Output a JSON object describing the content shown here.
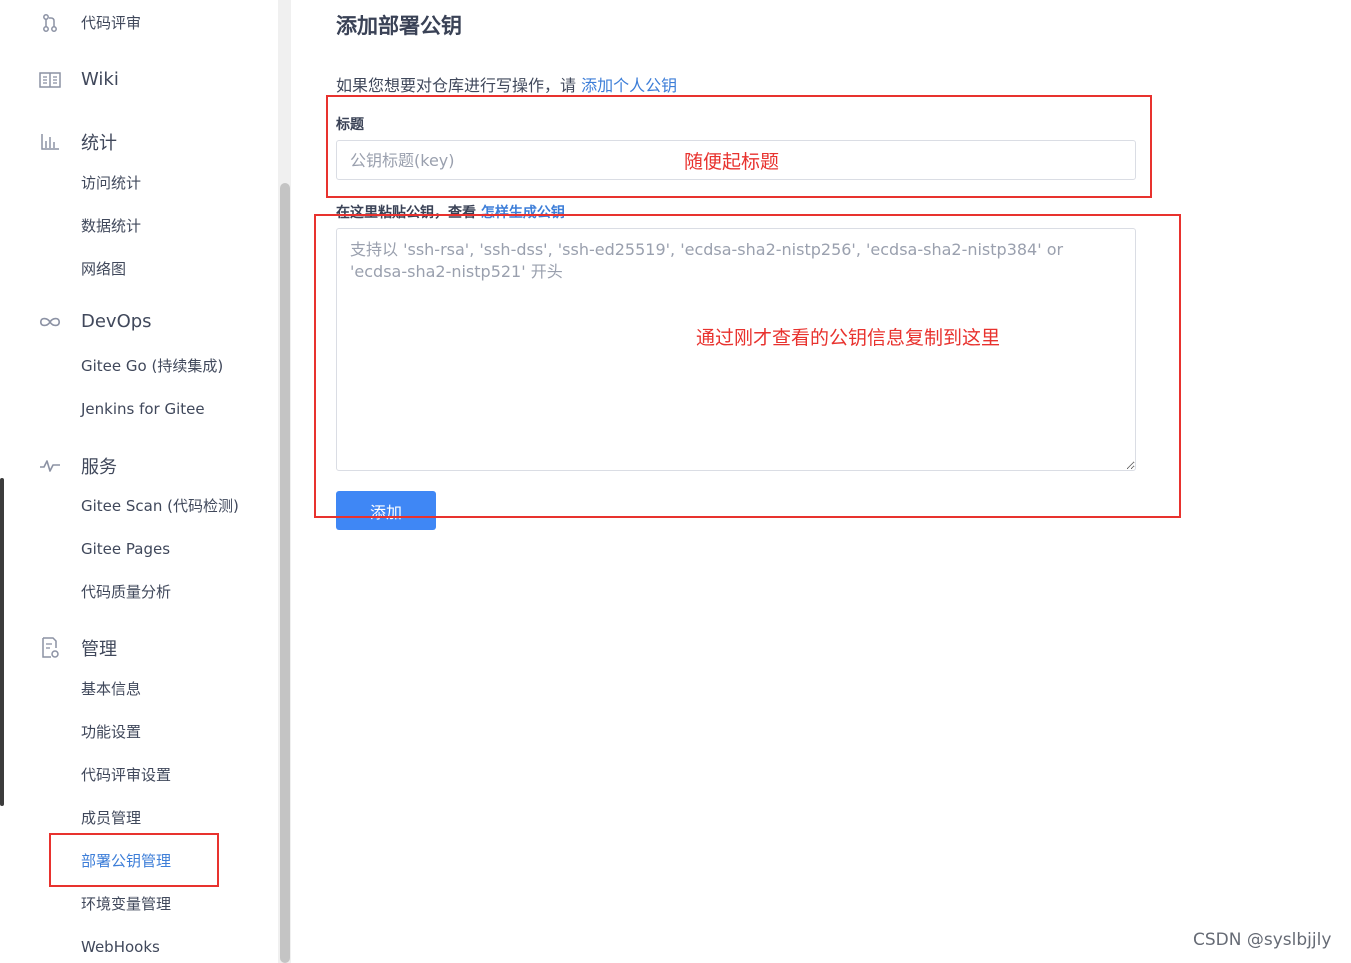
{
  "sidebar": {
    "groups": [
      {
        "label": "代码评审",
        "icon": "code-review-icon"
      },
      {
        "label": "Wiki",
        "icon": "wiki-icon"
      },
      {
        "label": "统计",
        "icon": "stats-icon"
      },
      {
        "label": "DevOps",
        "icon": "devops-infinity-icon"
      },
      {
        "label": "服务",
        "icon": "service-pulse-icon"
      },
      {
        "label": "管理",
        "icon": "manage-icon"
      }
    ],
    "stats_items": [
      "访问统计",
      "数据统计",
      "网络图"
    ],
    "devops_items": [
      "Gitee Go (持续集成)",
      "Jenkins for Gitee"
    ],
    "service_items": [
      "Gitee Scan (代码检测)",
      "Gitee Pages",
      "代码质量分析"
    ],
    "manage_items": [
      "基本信息",
      "功能设置",
      "代码评审设置",
      "成员管理",
      "部署公钥管理",
      "环境变量管理",
      "WebHooks"
    ],
    "active_item": "部署公钥管理"
  },
  "main": {
    "title": "添加部署公钥",
    "intro_text": "如果您想要对仓库进行写操作，请 ",
    "intro_link": "添加个人公钥",
    "title_label": "标题",
    "title_placeholder": "公钥标题(key)",
    "key_label": "在这里粘贴公钥，查看 ",
    "key_label_link": "怎样生成公钥",
    "key_placeholder": "支持以 'ssh-rsa', 'ssh-dss', 'ssh-ed25519', 'ecdsa-sha2-nistp256', 'ecdsa-sha2-nistp384' or 'ecdsa-sha2-nistp521' 开头",
    "add_button": "添加"
  },
  "annotations": {
    "title_note": "随便起标题",
    "key_note": "通过刚才查看的公钥信息复制到这里"
  },
  "watermark": "CSDN @syslbjjly",
  "colors": {
    "link": "#3d7ed8",
    "primary_button": "#3f87f5",
    "annotation_red": "#e8322e",
    "text": "#40485b"
  }
}
